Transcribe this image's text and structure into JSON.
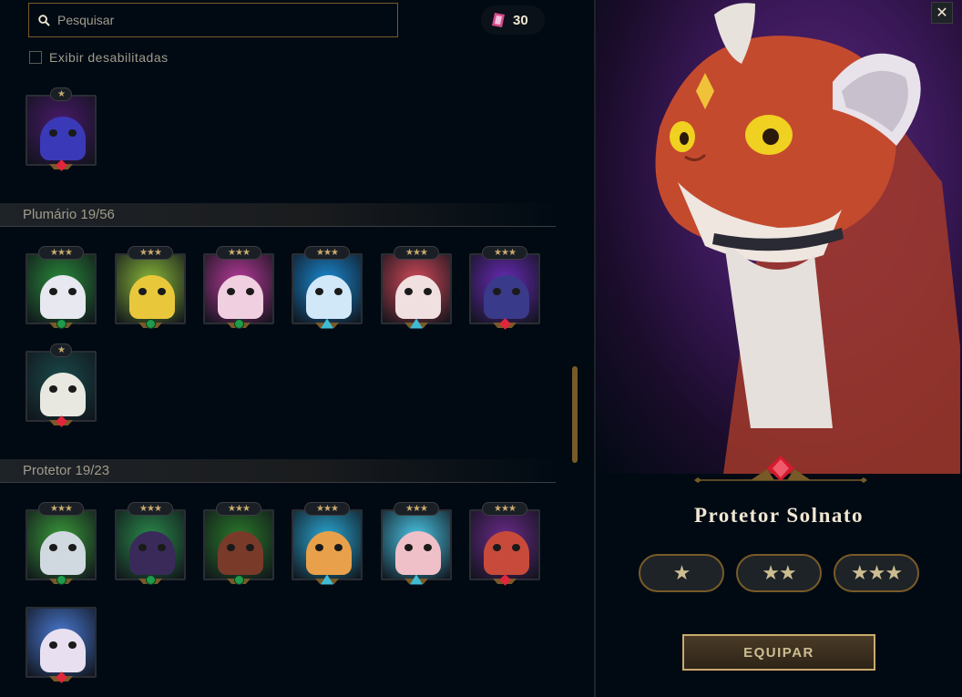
{
  "search": {
    "placeholder": "Pesquisar"
  },
  "currency": {
    "value": "30",
    "icon": "gem-currency-icon",
    "color": "#d44a8a"
  },
  "filter": {
    "label": "Exibir desabilitadas",
    "checked": false
  },
  "sections": [
    {
      "title": "Plumário 19/56"
    },
    {
      "title": "Protetor 19/23"
    }
  ],
  "tiles": {
    "top": [
      {
        "stars": "★",
        "gem": "red",
        "colors": [
          "#4a1a6b",
          "#3a3ab8"
        ]
      }
    ],
    "plumario": [
      {
        "stars": "★★★",
        "gem": "green",
        "colors": [
          "#2a8a3a",
          "#e8e8f0"
        ]
      },
      {
        "stars": "★★★",
        "gem": "green",
        "colors": [
          "#8ab83a",
          "#e8c83a"
        ]
      },
      {
        "stars": "★★★",
        "gem": "green",
        "colors": [
          "#b83a9a",
          "#f0d0e0"
        ]
      },
      {
        "stars": "★★★",
        "gem": "blue",
        "colors": [
          "#1a8ad4",
          "#d0e8f8"
        ]
      },
      {
        "stars": "★★★",
        "gem": "blue",
        "colors": [
          "#d44a5a",
          "#f0e0e0"
        ]
      },
      {
        "stars": "★★★",
        "gem": "red",
        "colors": [
          "#6a2ab8",
          "#3a3a8a"
        ]
      },
      {
        "stars": "★",
        "gem": "red",
        "colors": [
          "#1a4a4a",
          "#e8e8e0"
        ]
      }
    ],
    "protetor": [
      {
        "stars": "★★★",
        "gem": "green",
        "colors": [
          "#3a9a3a",
          "#d0d8e0"
        ]
      },
      {
        "stars": "★★★",
        "gem": "green",
        "colors": [
          "#2a8a4a",
          "#3a2a5a"
        ]
      },
      {
        "stars": "★★★",
        "gem": "green",
        "colors": [
          "#2a7a2a",
          "#7a3a2a"
        ]
      },
      {
        "stars": "★★★",
        "gem": "blue",
        "colors": [
          "#2aa8d4",
          "#e8a04a"
        ]
      },
      {
        "stars": "★★★",
        "gem": "blue",
        "colors": [
          "#4ac8e8",
          "#f0c0c8"
        ]
      },
      {
        "stars": "★★★",
        "gem": "red",
        "colors": [
          "#6a2a8a",
          "#c84a3a"
        ]
      },
      {
        "stars": "",
        "gem": "red",
        "colors": [
          "#4a7ad4",
          "#e8e0f0"
        ]
      }
    ]
  },
  "detail": {
    "name": "Protetor Solnato",
    "star_options": [
      "★",
      "★★",
      "★★★"
    ],
    "equip_label": "EQUIPAR",
    "close": "✕",
    "rarity_gem": "red-gem-icon"
  }
}
